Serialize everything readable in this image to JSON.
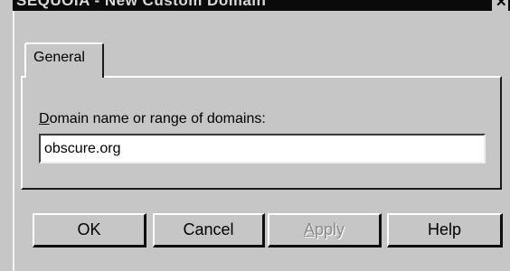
{
  "window": {
    "title": "SEQUOIA - New Custom Domain",
    "close_glyph": "✕"
  },
  "tabs": [
    {
      "label": "General",
      "selected": true
    }
  ],
  "form": {
    "label_first": "D",
    "label_rest": "omain name or range of domains:",
    "value": "obscure.org"
  },
  "buttons": {
    "ok": "OK",
    "cancel": "Cancel",
    "apply_first": "A",
    "apply_rest": "pply",
    "apply_enabled": false,
    "help": "Help"
  },
  "colors": {
    "face": "#c6c6c6",
    "titlebar": "#0a0a0a",
    "input_bg": "#ffffff",
    "disabled_text": "#8a8a8a"
  }
}
